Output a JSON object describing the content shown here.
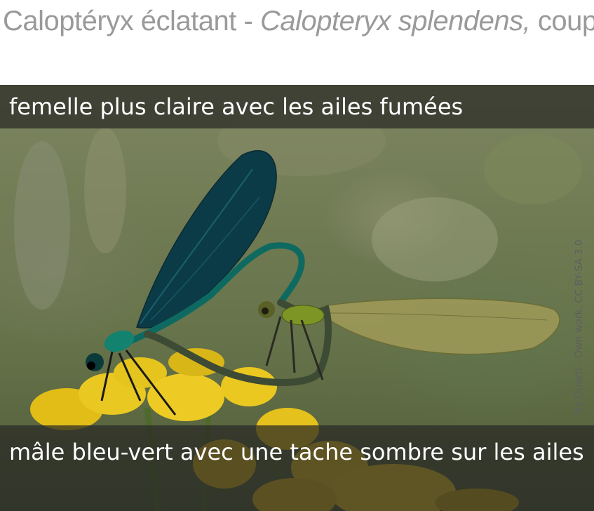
{
  "title": {
    "common_name": "Caloptéryx éclatant - ",
    "scientific_name": "Calopteryx splendens,",
    "suffix": " couple"
  },
  "captions": {
    "female": "femelle plus claire avec les ailes fumées",
    "male": "mâle bleu-vert avec une tache sombre sur les ailes"
  },
  "credit": "By Quartl - Own work, CC BY-SA 3.0",
  "colors": {
    "male_body": "#0f6f64",
    "male_wing": "#0b3f4a",
    "female_body": "#6f8a1e",
    "female_wing": "#8b8a4a",
    "flower": "#e7c520",
    "caption_band": "#28282b"
  }
}
